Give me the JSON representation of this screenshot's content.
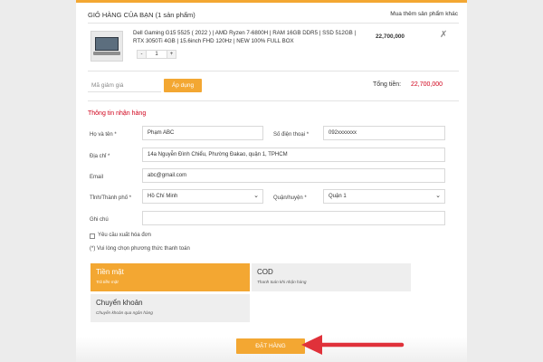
{
  "cart": {
    "title": "GIỎ HÀNG CỦA BẠN (1 sản phẩm)",
    "more_link": "Mua thêm sản phẩm khác",
    "item": {
      "name": "Dell Gaming G15 5525 ( 2022 ) | AMD Ryzen 7-6800H | RAM 16GB DDR5 | SSD 512GB | RTX 3050Ti 4GB | 15.6inch FHD 120Hz | NEW 100% FULL BOX",
      "price": "22,700,000",
      "quantity": "1",
      "minus": "-",
      "plus": "+",
      "remove": "✗"
    },
    "coupon_placeholder": "Mã giảm giá",
    "apply_label": "Áp dụng",
    "total_label": "Tổng tiền:",
    "total_value": "22,700,000"
  },
  "form": {
    "section_title": "Thông tin nhận hàng",
    "name_label": "Họ và tên *",
    "name_value": "Phạm ABC",
    "phone_label": "Số điện thoại *",
    "phone_value": "092xxxxxxx",
    "address_label": "Địa chỉ *",
    "address_value": "14a Nguyễn Đình Chiểu, Phường Đakao, quận 1, TPHCM",
    "email_label": "Email",
    "email_value": "abc@gmail.com",
    "city_label": "Tỉnh/Thành phố *",
    "city_value": "Hồ Chí Minh",
    "district_label": "Quận/huyện *",
    "district_value": "Quận 1",
    "note_label": "Ghi chú",
    "invoice_label": "Yêu cầu xuất hóa đơn",
    "payment_note": "(*) Vui lòng chọn phương thức thanh toán"
  },
  "payment": [
    {
      "title": "Tiền mặt",
      "subtitle": "Trả tiền mặt",
      "selected": true
    },
    {
      "title": "COD",
      "subtitle": "Thanh toán khi nhận hàng",
      "selected": false
    },
    {
      "title": "Chuyển khoản",
      "subtitle": "Chuyển khoản qua ngân hàng",
      "selected": false
    }
  ],
  "order_button": "ĐẶT HÀNG",
  "colors": {
    "accent": "#f3a732",
    "total": "#d0021b",
    "arrow": "#e0313a"
  }
}
